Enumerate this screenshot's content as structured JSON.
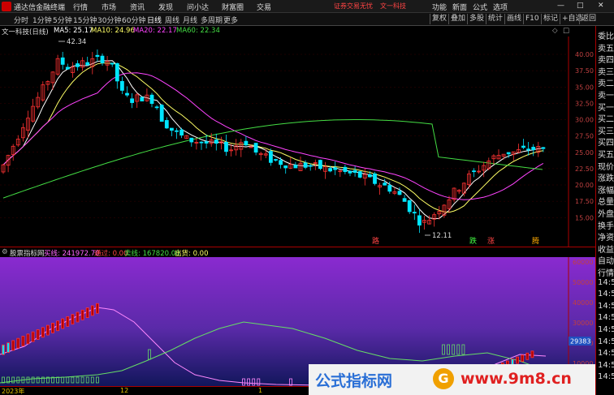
{
  "titlebar": {
    "app_title": "通达信金融终端",
    "menus": [
      "行情",
      "市场",
      "资讯",
      "发现",
      "问小达",
      "财富圈",
      "交易"
    ],
    "promo_text": "证券交易无忧",
    "promo_stock": "文一科技",
    "right_menus": [
      "功能",
      "新面",
      "公式",
      "选项"
    ],
    "window_buttons": [
      "—",
      "□",
      "✕"
    ]
  },
  "toolbar": {
    "periods": [
      "分时",
      "1分钟",
      "5分钟",
      "15分钟",
      "30分钟",
      "60分钟",
      "日线",
      "周线",
      "月线",
      "多周期",
      "更多"
    ],
    "active_period": "日线",
    "right_buttons": [
      "复权",
      "叠加",
      "多股",
      "统计",
      "画线",
      "F10",
      "标记",
      "+自选",
      "返回"
    ]
  },
  "info": {
    "stock": "文一科技(日线)",
    "ma5": "MA5: 25.17",
    "ma10": "MA10: 24.96",
    "ma20": "MA20: 22.17",
    "ma60": "MA60: 22.34"
  },
  "main_chart": {
    "price_labels": [
      "40.00",
      "37.50",
      "35.00",
      "32.50",
      "30.00",
      "27.50",
      "25.00",
      "22.50",
      "20.00",
      "17.50",
      "15.00"
    ],
    "high_label": "42.34",
    "low_label": "12.11",
    "signals": [
      "路",
      "跌",
      "涨",
      "腾"
    ]
  },
  "sub_chart": {
    "title": "股票指标网",
    "buy": "买线: 241972.70",
    "pass": "通过: 0.00",
    "sell": "卖线: 167820.00",
    "out": "出货: 0.00",
    "y_labels": [
      "60000",
      "50000",
      "40000",
      "30000",
      "20000",
      "10000"
    ],
    "marker_value": "29383"
  },
  "bottom_axis": {
    "labels": [
      "2023年",
      "12",
      "1"
    ]
  },
  "right_panel": {
    "items": [
      "委比",
      "卖五",
      "卖四",
      "卖三",
      "卖二",
      "卖一",
      "买一",
      "买二",
      "买三",
      "买四",
      "买五",
      "现价",
      "涨跌",
      "涨幅",
      "总量",
      "外盘",
      "换手",
      "净资",
      "收益",
      "自动",
      "行情",
      "14:5",
      "14:5",
      "14:5",
      "14:5",
      "14:5",
      "14:5",
      "14:5",
      "14:5",
      "14:5"
    ]
  },
  "banner": {
    "left_text": "公式指标网",
    "coin_text": "G",
    "right_text": "www.9m8.cn"
  },
  "colors": {
    "up": "#ff3232",
    "down": "#00e5ff",
    "ma5": "#ffffff",
    "ma10": "#ffff66",
    "ma20": "#ff44ff",
    "ma60": "#44dd44"
  }
}
